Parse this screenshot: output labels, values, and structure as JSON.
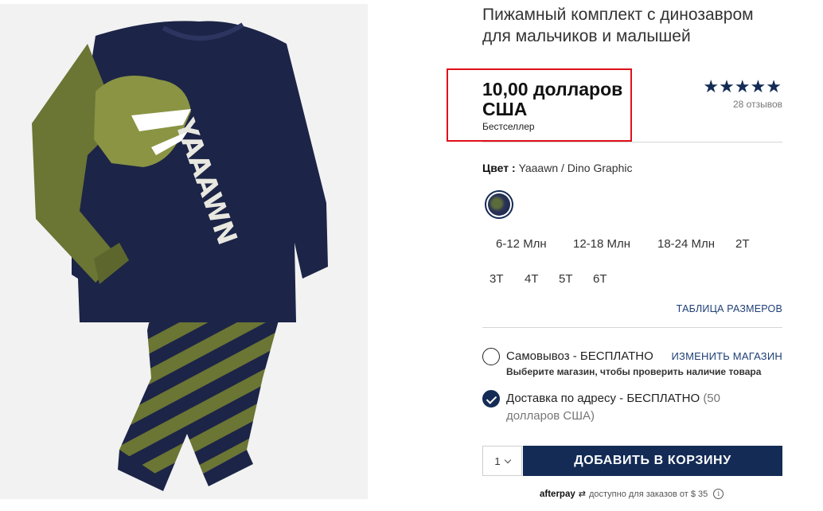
{
  "product": {
    "title": "Пижамный комплект с динозавром для мальчиков и малышей",
    "price": "10,00 долларов США",
    "badge": "Бестселлер",
    "rating_stars": "★★★★★",
    "rating": 5,
    "reviews": "28 отзывов",
    "image": {
      "alt_icon": "product-photo",
      "print_text": "YAAAWN"
    }
  },
  "color": {
    "label": "Цвет :",
    "value": "Yaaawn / Dino Graphic"
  },
  "sizes": [
    "6-12 Млн",
    "12-18 Млн",
    "18-24 Млн",
    "2T",
    "3T",
    "4T",
    "5T",
    "6T"
  ],
  "size_chart_link": "ТАБЛИЦА РАЗМЕРОВ",
  "fulfillment": {
    "pickup": {
      "title": "Самовывоз - БЕСПЛАТНО",
      "subtitle": "Выберите магазин, чтобы проверить наличие товара",
      "change_store": "ИЗМЕНИТЬ МАГАЗИН",
      "selected": false
    },
    "delivery": {
      "title": "Доставка по адресу - БЕСПЛАТНО",
      "note": "(50 долларов США)",
      "selected": true
    }
  },
  "cart": {
    "quantity": "1",
    "add_button": "ДОБАВИТЬ В КОРЗИНУ"
  },
  "afterpay": {
    "logo": "afterpay",
    "mark": "⇄",
    "text": "доступно для заказов от $ 35",
    "info": "i"
  },
  "colors": {
    "navy": "#132b55",
    "highlight": "#e0101a",
    "link": "#1e3f77"
  }
}
